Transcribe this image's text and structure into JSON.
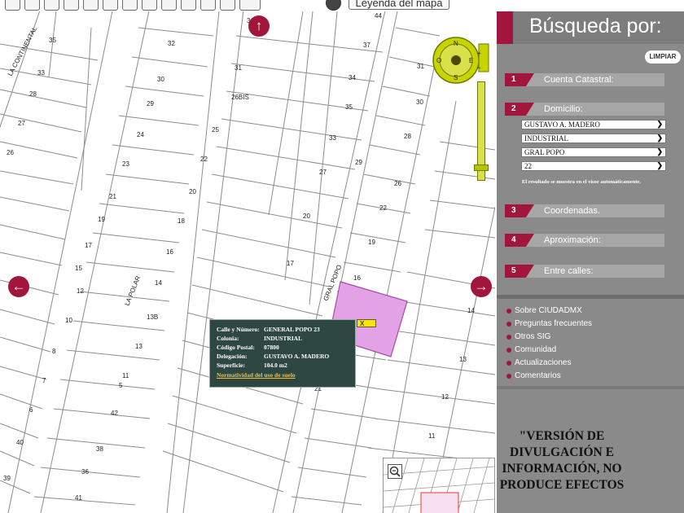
{
  "toolbar": {
    "legend_label": "Leyenda del mapa"
  },
  "map": {
    "lot_numbers": [
      "35",
      "32",
      "34",
      "44",
      "33",
      "30",
      "31",
      "28",
      "29",
      "26BIS",
      "27",
      "24",
      "25",
      "26",
      "23",
      "22",
      "21",
      "20",
      "19",
      "18",
      "17",
      "16",
      "15",
      "14",
      "12",
      "13B",
      "10",
      "13",
      "8",
      "11",
      "7",
      "5",
      "6",
      "42",
      "40",
      "38",
      "36",
      "41",
      "39",
      "37",
      "34",
      "35",
      "33",
      "31",
      "30",
      "29",
      "28",
      "27",
      "26",
      "22",
      "20",
      "19",
      "17",
      "16",
      "14",
      "13",
      "12",
      "11",
      "21"
    ],
    "street_names": [
      "LA CONTINENTAL",
      "LA POLAR",
      "GRAL POPO"
    ],
    "colors": {
      "accent": "#a3163c",
      "lot_highlight": "#e3a2e6"
    }
  },
  "popup": {
    "rows": [
      {
        "key": "Calle y Número:",
        "value": "GENERAL POPO 23"
      },
      {
        "key": "Colonia:",
        "value": "INDUSTRIAL"
      },
      {
        "key": "Código Postal:",
        "value": "07800"
      },
      {
        "key": "Delegación:",
        "value": "GUSTAVO A. MADERO"
      },
      {
        "key": "Superficie:",
        "value": "104.0 m2"
      }
    ],
    "link": "Normatividad del uso de suelo",
    "close": "X"
  },
  "compass": {
    "n": "N",
    "s": "S",
    "e": "E",
    "o": "O"
  },
  "panel": {
    "title": "Búsqueda por:",
    "clear_label": "LIMPIAR",
    "sections": [
      {
        "num": "1",
        "label": "Cuenta Catastral:"
      },
      {
        "num": "2",
        "label": "Domicilio:"
      },
      {
        "num": "3",
        "label": "Coordenadas."
      },
      {
        "num": "4",
        "label": "Aproximación:"
      },
      {
        "num": "5",
        "label": "Entre calles:"
      }
    ],
    "selects": [
      "GUSTAVO A. MADERO",
      "INDUSTRIAL",
      "GRAL POPO",
      "22"
    ],
    "auto_note": "El resultado se muestra en el visor automáticamente.",
    "links": [
      "Sobre CIUDADMX",
      "Preguntas frecuentes",
      "Otros SIG",
      "Comunidad",
      "Actualizaciones",
      "Comentarios"
    ],
    "disclaimer": "\"VERSIÓN DE DIVULGACIÓN E INFORMACIÓN, NO PRODUCE EFECTOS"
  }
}
